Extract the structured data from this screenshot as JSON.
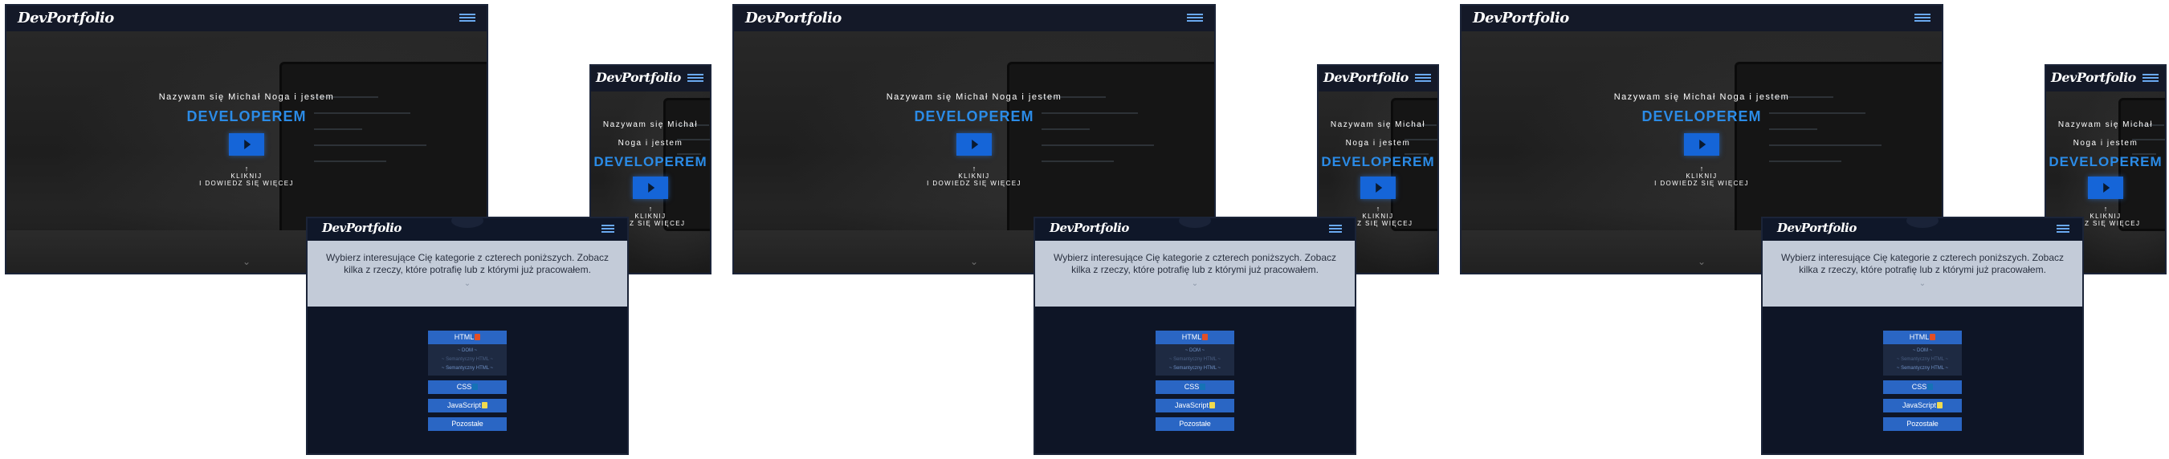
{
  "logo": "DevPortfolio",
  "hero": {
    "intro_wide": "Nazywam się Michał Noga i jestem",
    "intro_line1": "Nazywam się Michał",
    "intro_line2": "Noga i jestem",
    "role": "DEVELOPEREM",
    "arrow": "↑",
    "click_line1": "KLIKNIJ",
    "click_line2": "I DOWIEDZ SIĘ WIĘCEJ",
    "click_line2_cropped": "IEDZ SIĘ WIĘCEJ",
    "scroll_chevron": "⌄"
  },
  "categories": {
    "intro": "Wybierz interesujące Cię kategorie z czterech poniższych. Zobacz kilka z rzeczy, które potrafię lub z którymi już pracowałem.",
    "chevron": "⌄",
    "items": [
      {
        "label": "HTML",
        "icon": "html5-icon",
        "color": "#e34f26"
      },
      {
        "label": "CSS",
        "icon": "css3-icon",
        "color": "#1572b6"
      },
      {
        "label": "JavaScript",
        "icon": "javascript-icon",
        "color": "#f0db4f"
      },
      {
        "label": "Pozostałe"
      }
    ],
    "html_sub": [
      "~ DOM ~",
      "~ Semantyczny HTML ~",
      "~ Semantyczny HTML ~"
    ]
  },
  "colors": {
    "accent": "#2b8be6",
    "button": "#2a66c4",
    "navbar": "#121828",
    "banner": "#c3cbd8"
  }
}
